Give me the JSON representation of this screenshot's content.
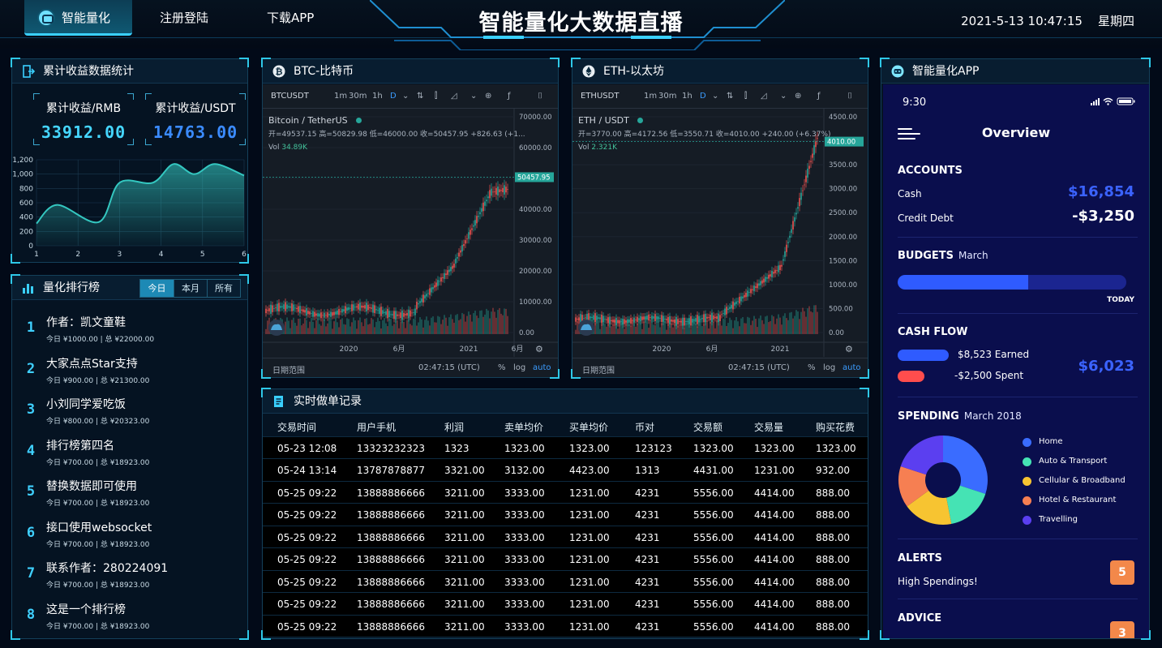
{
  "nav": {
    "home": "智能量化",
    "register": "注册登陆",
    "download": "下载APP"
  },
  "header": {
    "title": "智能量化大数据直播",
    "datetime": "2021-5-13 10:47:15",
    "weekday": "星期四"
  },
  "stats": {
    "title": "累计收益数据统计",
    "rmb_label": "累计收益/RMB",
    "rmb_value": "33912.00",
    "usdt_label": "累计收益/USDT",
    "usdt_value": "14763.00",
    "chart_data": {
      "type": "area",
      "x": [
        1,
        2,
        3,
        4,
        5,
        6
      ],
      "xticks": [
        "1",
        "2",
        "3",
        "4",
        "5",
        "6"
      ],
      "yticks": [
        "0",
        "200",
        "400",
        "600",
        "800",
        "1,000",
        "1,200"
      ],
      "ylim": [
        0,
        1200
      ],
      "xlim": [
        1,
        6
      ],
      "points": [
        [
          1,
          310
        ],
        [
          1.5,
          570
        ],
        [
          2.5,
          330
        ],
        [
          3,
          880
        ],
        [
          3.8,
          880
        ],
        [
          4.3,
          1140
        ],
        [
          4.8,
          1000
        ],
        [
          5.3,
          1140
        ],
        [
          6,
          980
        ]
      ],
      "color": "#34c7c0"
    }
  },
  "ranking": {
    "title": "量化排行榜",
    "tabs": [
      "今日",
      "本月",
      "所有"
    ],
    "items": [
      {
        "rank": "1",
        "name": "作者：凯文童鞋",
        "sub": "今日 ¥1000.00 | 总 ¥22000.00"
      },
      {
        "rank": "2",
        "name": "大家点点Star支持",
        "sub": "今日 ¥900.00 | 总 ¥21300.00"
      },
      {
        "rank": "3",
        "name": "小刘同学爱吃饭",
        "sub": "今日 ¥800.00 | 总 ¥20323.00"
      },
      {
        "rank": "4",
        "name": "排行榜第四名",
        "sub": "今日 ¥700.00 | 总 ¥18923.00"
      },
      {
        "rank": "5",
        "name": "替换数据即可使用",
        "sub": "今日 ¥700.00 | 总 ¥18923.00"
      },
      {
        "rank": "6",
        "name": "接口使用websocket",
        "sub": "今日 ¥700.00 | 总 ¥18923.00"
      },
      {
        "rank": "7",
        "name": "联系作者：280224091",
        "sub": "今日 ¥700.00 | 总 ¥18923.00"
      },
      {
        "rank": "8",
        "name": "这是一个排行榜",
        "sub": "今日 ¥700.00 | 总 ¥18923.00"
      }
    ]
  },
  "btc": {
    "title": "BTC-比特币",
    "symbol": "BTCUSDT",
    "intervals": [
      "1m",
      "30m",
      "1h",
      "D"
    ],
    "pair": "Bitcoin / TetherUS",
    "ohlc": "开=49537.15 高=50829.98 低=46000.00 收=50457.95 +826.63 (+1...",
    "vol_label": "Vol",
    "vol": "34.89K",
    "last_price": "50457.95",
    "yticks": [
      "70000.00",
      "60000.00",
      "50000.00",
      "40000.00",
      "30000.00",
      "20000.00",
      "10000.00",
      "0.00"
    ],
    "xticks": [
      "2020",
      "6月",
      "2021",
      "6月"
    ],
    "range_label": "日期范围",
    "time": "02:47:15 (UTC)",
    "pct": "%",
    "log": "log",
    "auto": "auto"
  },
  "eth": {
    "title": "ETH-以太坊",
    "symbol": "ETHUSDT",
    "intervals": [
      "1m",
      "30m",
      "1h",
      "D"
    ],
    "pair": "ETH / USDT",
    "ohlc": "开=3770.00 高=4172.56 低=3550.71 收=4010.00 +240.00 (+6.37%)",
    "vol_label": "Vol",
    "vol": "2.321K",
    "last_price": "4010.00",
    "yticks": [
      "4500.00",
      "4000.00",
      "3500.00",
      "3000.00",
      "2500.00",
      "2000.00",
      "1500.00",
      "1000.00",
      "500.00",
      "0.00"
    ],
    "xticks": [
      "2020",
      "6月",
      "2021"
    ],
    "range_label": "日期范围",
    "time": "02:47:15 (UTC)",
    "pct": "%",
    "log": "log",
    "auto": "auto"
  },
  "trades": {
    "title": "实时做单记录",
    "columns": [
      "交易时间",
      "用户手机",
      "利润",
      "卖单均价",
      "买单均价",
      "币对",
      "交易额",
      "交易量",
      "购买花费"
    ],
    "rows": [
      [
        "05-23 12:08",
        "13323232323",
        "1323",
        "1323.00",
        "1323.00",
        "123123",
        "1323.00",
        "1323.00",
        "1323.00"
      ],
      [
        "05-24 13:14",
        "13787878877",
        "3321.00",
        "3132.00",
        "4423.00",
        "1313",
        "4431.00",
        "1231.00",
        "932.00"
      ],
      [
        "05-25 09:22",
        "13888886666",
        "3211.00",
        "3333.00",
        "1231.00",
        "4231",
        "5556.00",
        "4414.00",
        "888.00"
      ],
      [
        "05-25 09:22",
        "13888886666",
        "3211.00",
        "3333.00",
        "1231.00",
        "4231",
        "5556.00",
        "4414.00",
        "888.00"
      ],
      [
        "05-25 09:22",
        "13888886666",
        "3211.00",
        "3333.00",
        "1231.00",
        "4231",
        "5556.00",
        "4414.00",
        "888.00"
      ],
      [
        "05-25 09:22",
        "13888886666",
        "3211.00",
        "3333.00",
        "1231.00",
        "4231",
        "5556.00",
        "4414.00",
        "888.00"
      ],
      [
        "05-25 09:22",
        "13888886666",
        "3211.00",
        "3333.00",
        "1231.00",
        "4231",
        "5556.00",
        "4414.00",
        "888.00"
      ],
      [
        "05-25 09:22",
        "13888886666",
        "3211.00",
        "3333.00",
        "1231.00",
        "4231",
        "5556.00",
        "4414.00",
        "888.00"
      ],
      [
        "05-25 09:22",
        "13888886666",
        "3211.00",
        "3333.00",
        "1231.00",
        "4231",
        "5556.00",
        "4414.00",
        "888.00"
      ]
    ]
  },
  "app": {
    "title": "智能量化APP",
    "time": "9:30",
    "screen_title": "Overview",
    "accounts": {
      "title": "ACCOUNTS",
      "cash_label": "Cash",
      "cash": "$16,854",
      "debt_label": "Credit Debt",
      "debt": "-$3,250"
    },
    "budgets": {
      "title": "BUDGETS",
      "month": "March",
      "progress": 0.57,
      "today": "TODAY"
    },
    "cashflow": {
      "title": "CASH FLOW",
      "earned": "$8,523 Earned",
      "spent": "-$2,500 Spent",
      "total": "$6,023"
    },
    "spending": {
      "title": "SPENDING",
      "period": "March 2018",
      "categories": [
        {
          "name": "Home",
          "color": "#3a6cff",
          "value": 0.3
        },
        {
          "name": "Auto & Transport",
          "color": "#45e3b4",
          "value": 0.17
        },
        {
          "name": "Cellular & Broadband",
          "color": "#f7c431",
          "value": 0.18
        },
        {
          "name": "Hotel & Restaurant",
          "color": "#f67f52",
          "value": 0.15
        },
        {
          "name": "Travelling",
          "color": "#5b3ff0",
          "value": 0.2
        }
      ]
    },
    "alerts": {
      "title": "ALERTS",
      "text": "High Spendings!",
      "count": "5"
    },
    "advice": {
      "title": "ADVICE",
      "count": "3"
    },
    "colors": {
      "accent": "#3b63ff",
      "earned": "#2f5bff",
      "spent": "#ff4d4d",
      "total": "#3b63ff"
    }
  }
}
